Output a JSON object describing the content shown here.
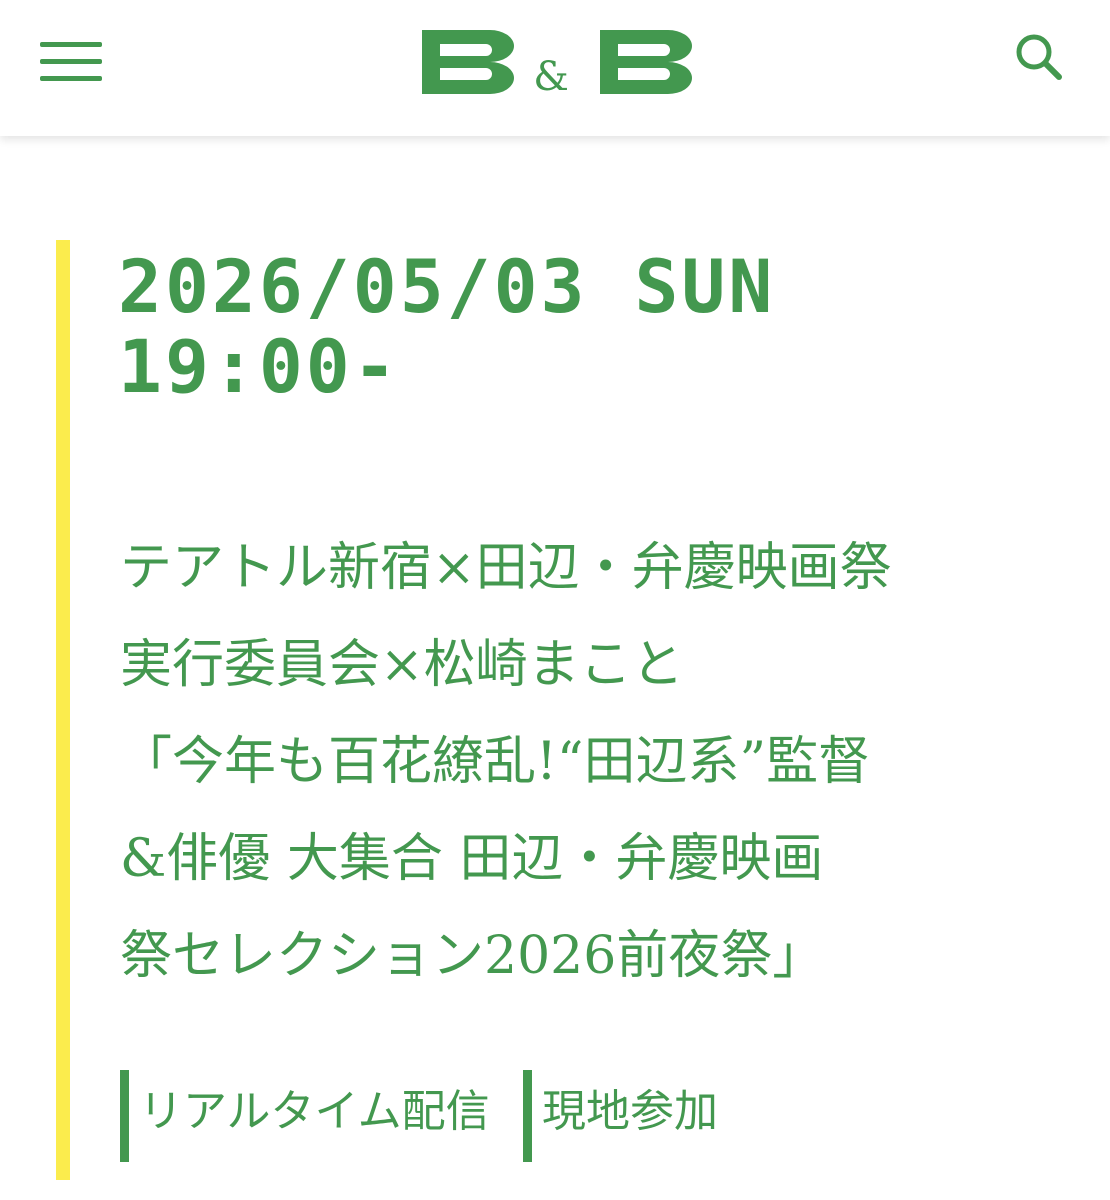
{
  "header": {
    "menu_icon": "hamburger-menu-icon",
    "logo_text": "B&B",
    "search_icon": "search-icon"
  },
  "colors": {
    "brand_green": "#43984f",
    "accent_yellow": "#fbec4d"
  },
  "event": {
    "date": "2026/05/03 SUN",
    "time": "19:00-",
    "title_lines": [
      "テアトル新宿×田辺・弁慶映画祭",
      "実行委員会×松崎まこと",
      "「今年も百花繚乱!“田辺系”監督",
      "&俳優 大集合 田辺・弁慶映画",
      "祭セレクション2026前夜祭」"
    ],
    "tags": [
      "リアルタイム配信",
      "現地参加"
    ]
  }
}
